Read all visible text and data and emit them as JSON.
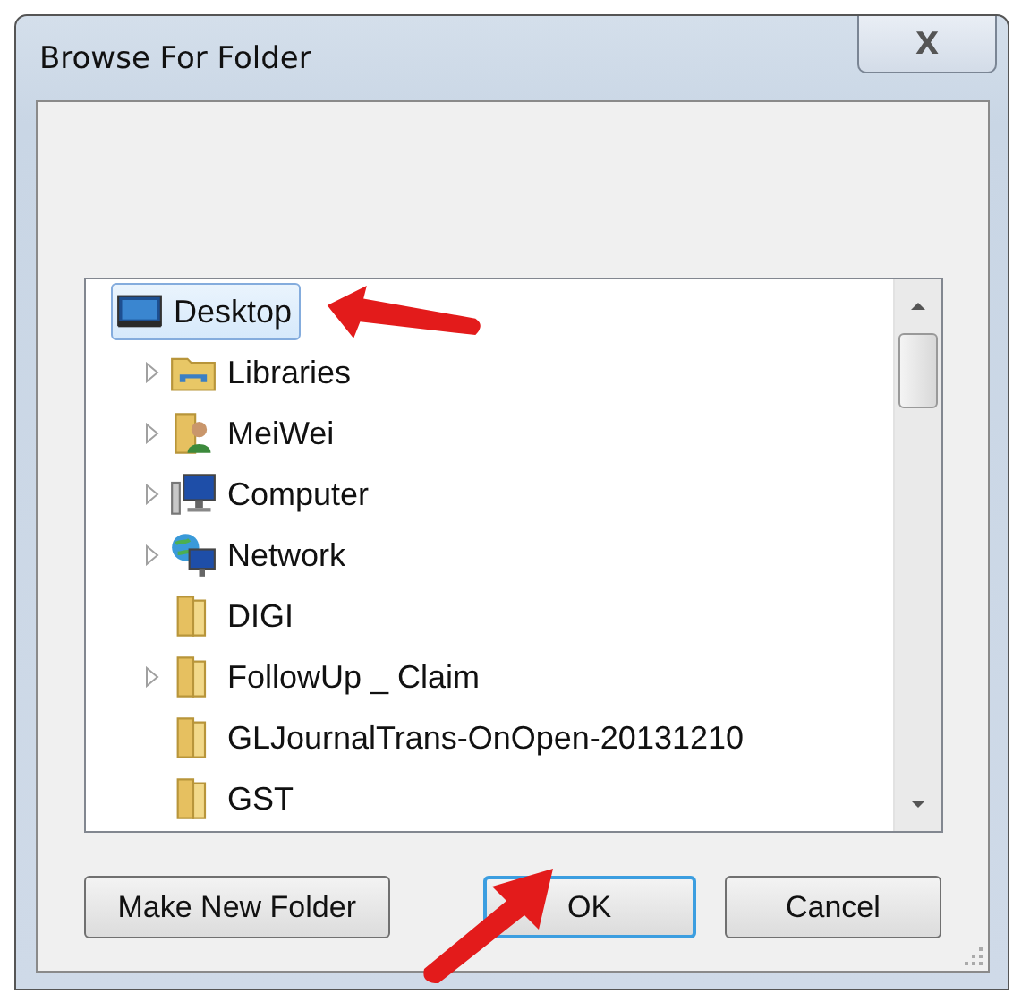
{
  "window": {
    "title": "Browse For Folder",
    "close_label": "X"
  },
  "tree": {
    "items": [
      {
        "label": "Desktop",
        "kind": "desktop",
        "selected": true,
        "children": [
          {
            "label": "Libraries",
            "kind": "library",
            "selected": false,
            "expandable": true
          },
          {
            "label": "MeiWei",
            "kind": "user",
            "selected": false,
            "expandable": true
          },
          {
            "label": "Computer",
            "kind": "computer",
            "selected": false,
            "expandable": true
          },
          {
            "label": "Network",
            "kind": "network",
            "selected": false,
            "expandable": true
          },
          {
            "label": "DIGI",
            "kind": "folder",
            "selected": false,
            "expandable": false
          },
          {
            "label": "FollowUp _ Claim",
            "kind": "folder",
            "selected": false,
            "expandable": true
          },
          {
            "label": "GLJournalTrans-OnOpen-20131210",
            "kind": "folder",
            "selected": false,
            "expandable": false
          },
          {
            "label": "GST",
            "kind": "folder",
            "selected": false,
            "expandable": false
          }
        ]
      }
    ]
  },
  "buttons": [
    {
      "label": "Make New Folder",
      "default": false
    },
    {
      "label": "OK",
      "default": true
    },
    {
      "label": "Cancel",
      "default": false
    }
  ]
}
